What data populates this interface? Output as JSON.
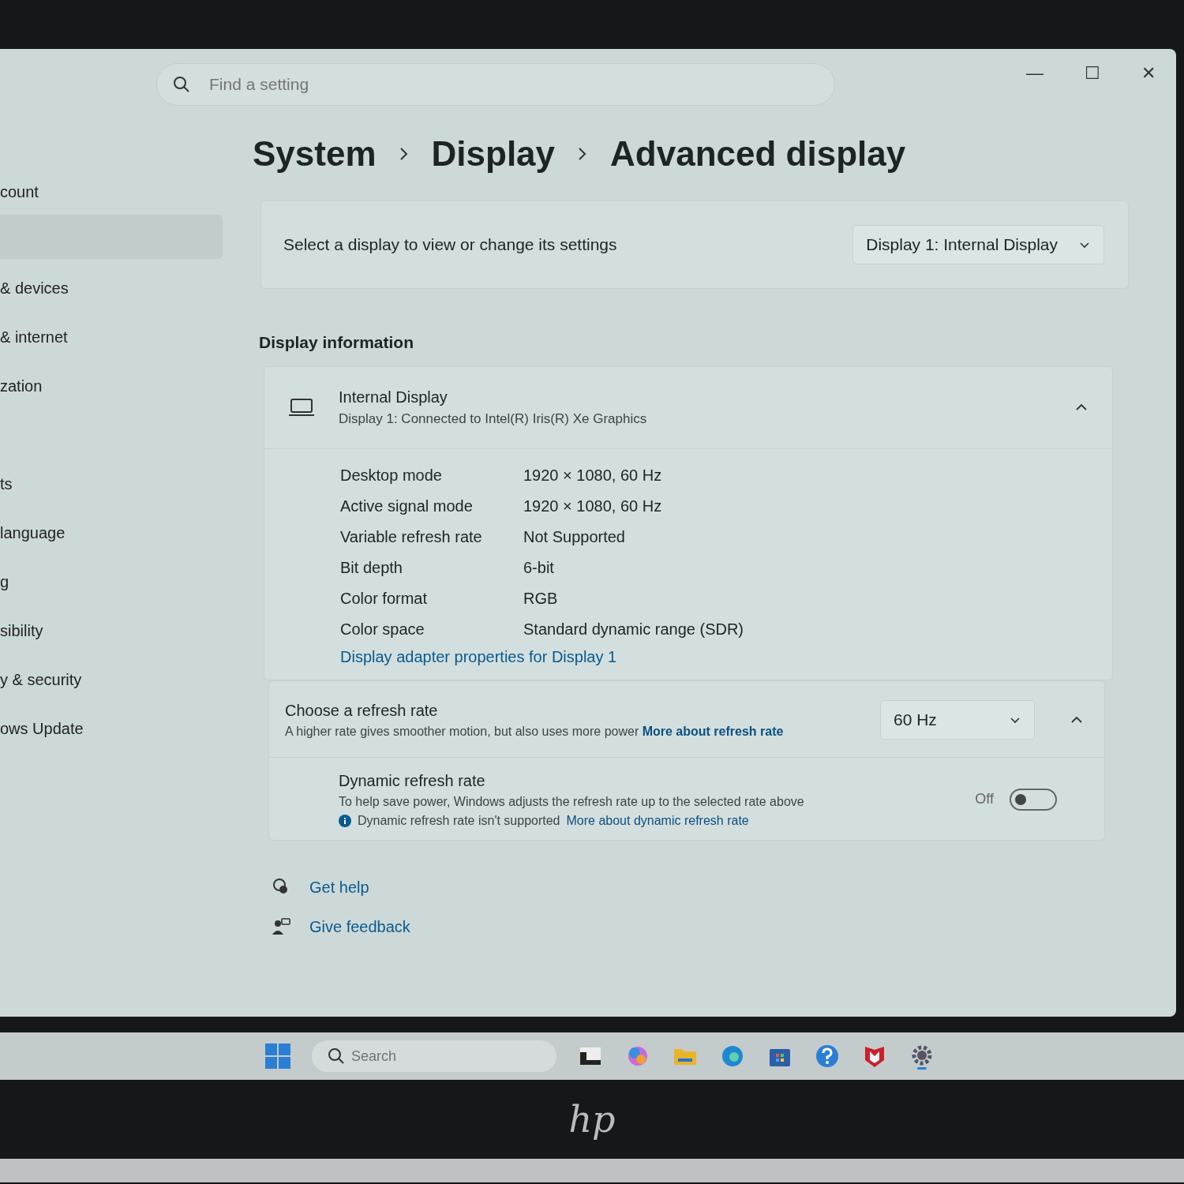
{
  "window": {
    "search": {
      "placeholder": "Find a setting"
    },
    "controls": [
      "—",
      "☐",
      "✕"
    ]
  },
  "sidebar": {
    "items": [
      {
        "label": "count",
        "selected": false
      },
      {
        "selected": true
      },
      {
        "label": "& devices",
        "selected": false
      },
      {
        "label": "& internet",
        "selected": false
      },
      {
        "label": "zation",
        "selected": false
      },
      {
        "label": "ts",
        "selected": false
      },
      {
        "label": "language",
        "selected": false
      },
      {
        "label": "g",
        "selected": false
      },
      {
        "label": "sibility",
        "selected": false
      },
      {
        "label": "y & security",
        "selected": false
      },
      {
        "label": "ows Update",
        "selected": false
      }
    ]
  },
  "breadcrumb": [
    "System",
    "Display",
    "Advanced display"
  ],
  "display_select": {
    "label": "Select a display to view or change its settings",
    "value": "Display 1: Internal Display"
  },
  "section_title": "Display information",
  "display_card": {
    "title": "Internal Display",
    "subtitle": "Display 1: Connected to Intel(R) Iris(R) Xe Graphics",
    "expanded": true,
    "rows": [
      {
        "label": "Desktop mode",
        "value": "1920 × 1080, 60 Hz"
      },
      {
        "label": "Active signal mode",
        "value": "1920 × 1080, 60 Hz"
      },
      {
        "label": "Variable refresh rate",
        "value": "Not Supported"
      },
      {
        "label": "Bit depth",
        "value": "6-bit"
      },
      {
        "label": "Color format",
        "value": "RGB"
      },
      {
        "label": "Color space",
        "value": "Standard dynamic range (SDR)"
      }
    ],
    "link": "Display adapter properties for Display 1"
  },
  "refresh_card": {
    "title": "Choose a refresh rate",
    "description": "A higher rate gives smoother motion, but also uses more power",
    "link": "More about refresh rate",
    "value": "60 Hz",
    "expanded": true,
    "dynamic": {
      "title": "Dynamic refresh rate",
      "description": "To help save power, Windows adjusts the refresh rate up to the selected rate above",
      "notice": "Dynamic refresh rate isn't supported",
      "link": "More about dynamic refresh rate",
      "state_label": "Off",
      "on": false
    }
  },
  "footer_links": [
    {
      "kind": "help",
      "label": "Get help"
    },
    {
      "kind": "feedback",
      "label": "Give feedback"
    }
  ],
  "taskbar": {
    "search": {
      "placeholder": "Search"
    }
  },
  "laptop_logo": "hp"
}
